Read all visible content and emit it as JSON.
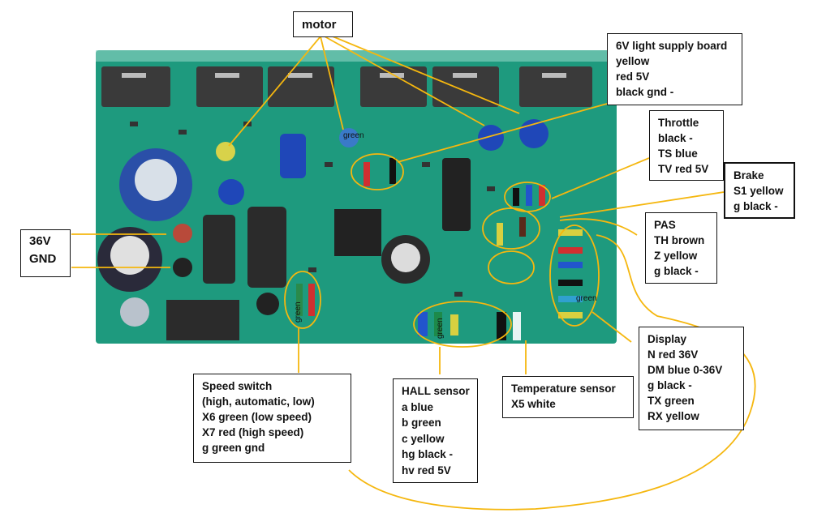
{
  "labels": {
    "motor": [
      "motor"
    ],
    "light_supply": [
      "6V light supply board",
      "yellow",
      "red 5V",
      "black gnd -"
    ],
    "throttle": [
      "Throttle",
      "black -",
      "TS blue",
      "TV red 5V"
    ],
    "brake": [
      "Brake",
      "S1 yellow",
      "g black -"
    ],
    "pas": [
      "PAS",
      "TH brown",
      "Z yellow",
      "g black -"
    ],
    "power": [
      "36V",
      "GND"
    ],
    "display": [
      "Display",
      "N red 36V",
      "DM blue 0-36V",
      "g black -",
      "TX green",
      "RX yellow"
    ],
    "speed_switch": [
      "Speed switch",
      "(high, automatic, low)",
      "X6 green (low speed)",
      "X7 red (high speed)",
      "g green gnd"
    ],
    "hall": [
      "HALL sensor",
      "a blue",
      "b green",
      "c yellow",
      "hg black -",
      "hv red 5V"
    ],
    "temperature": [
      "Temperature sensor",
      "X5 white"
    ]
  },
  "board_tags": [
    "green",
    "green",
    "green",
    "green"
  ],
  "colors": {
    "pcb": "#1e9a7e",
    "annotation_line": "#f5b70f",
    "heatsink": "#3a3a3a"
  }
}
